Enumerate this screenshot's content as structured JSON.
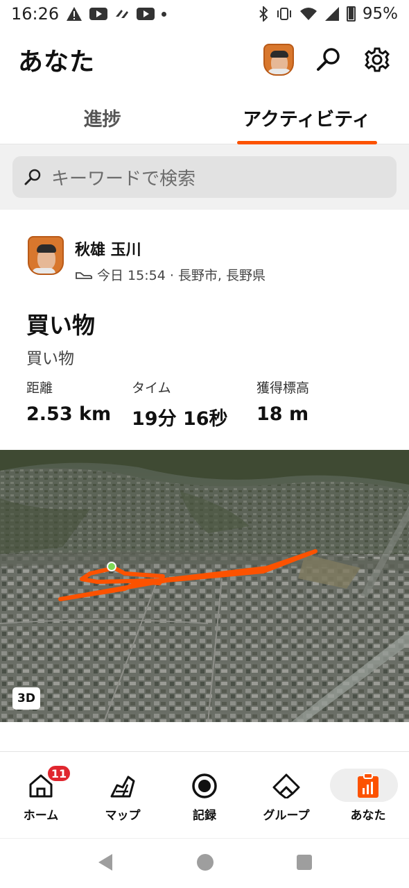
{
  "status_bar": {
    "time": "16:26",
    "battery": "95%",
    "icons": [
      "alert-icon",
      "youtube-icon",
      "app-icon",
      "youtube-icon",
      "dot-icon",
      "bluetooth-icon",
      "vibrate-icon",
      "wifi-icon",
      "signal-icon",
      "battery-icon"
    ]
  },
  "header": {
    "title": "あなた",
    "icons": [
      "avatar",
      "search-icon",
      "gear-icon"
    ]
  },
  "tabs": [
    {
      "label": "進捗",
      "active": false
    },
    {
      "label": "アクティビティ",
      "active": true
    }
  ],
  "search": {
    "placeholder": "キーワードで検索"
  },
  "activity": {
    "athlete_name": "秋雄 玉川",
    "meta": "今日 15:54 · 長野市, 長野県",
    "meta_icon": "shoe-icon",
    "title": "買い物",
    "description": "買い物",
    "stats": [
      {
        "label": "距離",
        "value": "2.53 km"
      },
      {
        "label": "タイム",
        "value": "19分 16秒"
      },
      {
        "label": "獲得標高",
        "value": "18 m"
      }
    ],
    "map_badge": "3D"
  },
  "bottom_nav": [
    {
      "label": "ホーム",
      "icon": "home-icon",
      "badge": "11"
    },
    {
      "label": "マップ",
      "icon": "map-icon"
    },
    {
      "label": "記録",
      "icon": "record-icon"
    },
    {
      "label": "グループ",
      "icon": "groups-icon"
    },
    {
      "label": "あなた",
      "icon": "profile-icon",
      "active": true
    }
  ],
  "colors": {
    "accent": "#fc5200",
    "badge": "#e0262e"
  }
}
